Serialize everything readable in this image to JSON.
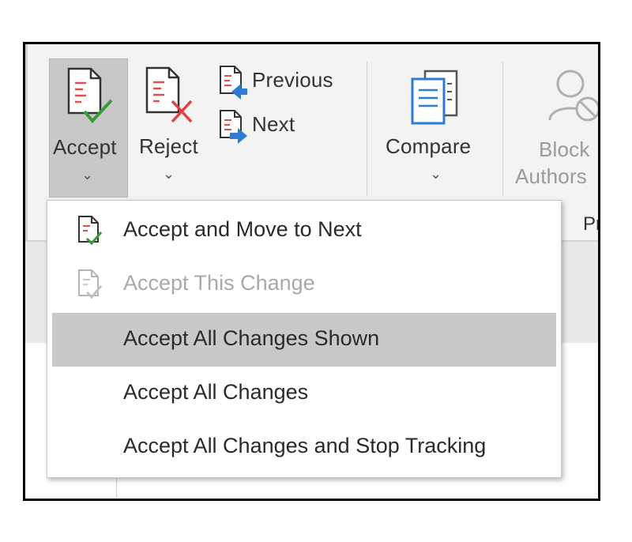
{
  "ribbon": {
    "accept_label": "Accept",
    "reject_label": "Reject",
    "previous_label": "Previous",
    "next_label": "Next",
    "compare_label": "Compare",
    "block_label_line1": "Block",
    "block_label_line2": "Authors",
    "group_label_partial": "Pr"
  },
  "accept_menu": {
    "items": [
      {
        "label": "Accept and Move to Next",
        "enabled": true,
        "icon": "accept-next-icon"
      },
      {
        "label": "Accept This Change",
        "enabled": false,
        "icon": "accept-change-icon"
      },
      {
        "label": "Accept All Changes Shown",
        "enabled": true,
        "highlighted": true
      },
      {
        "label": "Accept All Changes",
        "enabled": true
      },
      {
        "label": "Accept All Changes and Stop Tracking",
        "enabled": true
      }
    ]
  },
  "colors": {
    "accept_check": "#3a9a3a",
    "reject_x": "#e04040",
    "compare_blue": "#2f7bd1",
    "menu_highlight": "#c9c9c9"
  }
}
